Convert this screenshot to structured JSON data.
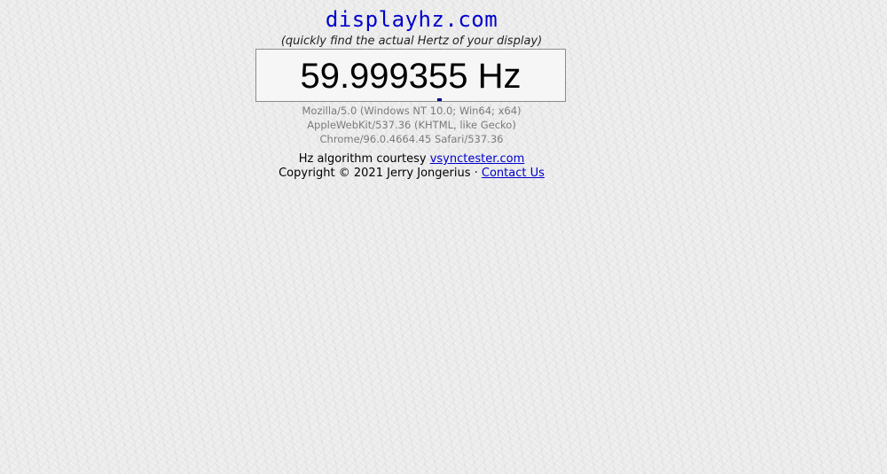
{
  "header": {
    "title": "displayhz.com",
    "subtitle": "(quickly find the actual Hertz of your display)"
  },
  "measurement": {
    "hz_text": "59.999355 Hz"
  },
  "user_agent": {
    "line1": "Mozilla/5.0 (Windows NT 10.0; Win64; x64)",
    "line2": "AppleWebKit/537.36 (KHTML, like Gecko)",
    "line3": "Chrome/96.0.4664.45 Safari/537.36"
  },
  "footer": {
    "courtesy_prefix": "Hz algorithm courtesy ",
    "courtesy_link": "vsynctester.com",
    "copyright": "Copyright © 2021 Jerry Jongerius · ",
    "contact_link": "Contact Us"
  },
  "colors": {
    "title": "#0000cc",
    "link": "#0000cc",
    "ua_text": "#7a7a7a",
    "background": "#ececec"
  }
}
